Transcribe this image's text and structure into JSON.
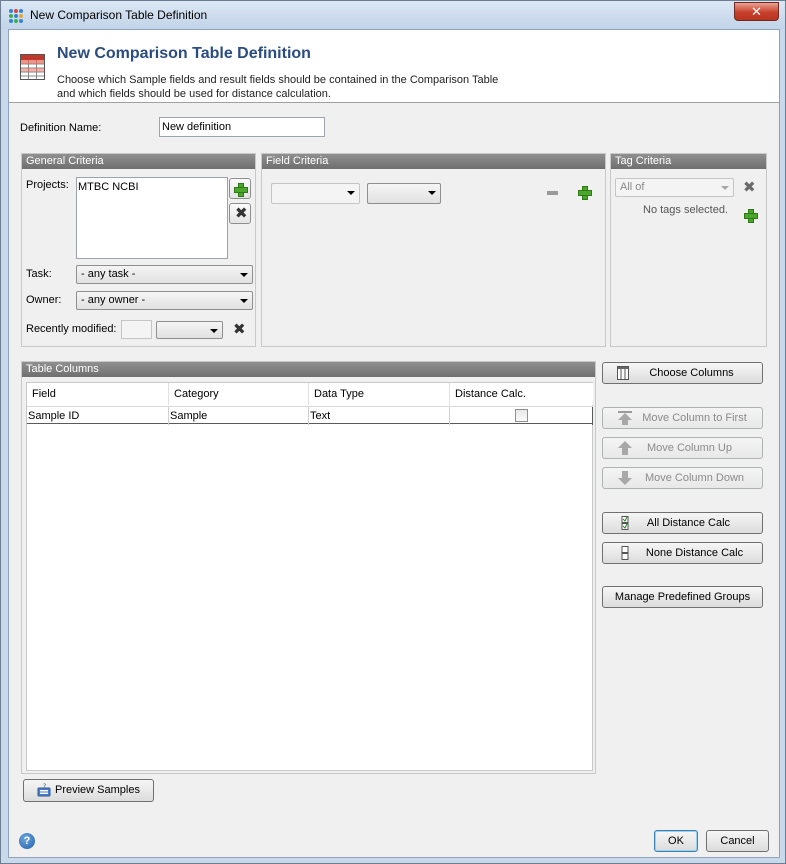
{
  "window": {
    "title": "New Comparison Table Definition",
    "close_glyph": "✕"
  },
  "header": {
    "title": "New Comparison Table Definition",
    "description_line1": "Choose which Sample fields and result fields should be contained in the Comparison Table",
    "description_line2": "and which fields should be used for distance calculation."
  },
  "definition": {
    "label": "Definition Name:",
    "value": "New definition"
  },
  "general_criteria": {
    "title": "General Criteria",
    "projects_label": "Projects:",
    "projects": [
      "MTBC NCBI"
    ],
    "task_label": "Task:",
    "task_value": "- any task -",
    "owner_label": "Owner:",
    "owner_value": "- any owner -",
    "recent_label": "Recently modified:",
    "recent_value": ""
  },
  "field_criteria": {
    "title": "Field Criteria",
    "field_value": "",
    "operator_value": ""
  },
  "tag_criteria": {
    "title": "Tag Criteria",
    "mode_value": "All of",
    "empty_text": "No tags selected."
  },
  "table_columns": {
    "title": "Table Columns",
    "headers": [
      "Field",
      "Category",
      "Data Type",
      "Distance Calc."
    ],
    "rows": [
      {
        "field": "Sample ID",
        "category": "Sample",
        "data_type": "Text",
        "distance_calc": false
      }
    ]
  },
  "side_buttons": {
    "choose_columns": "Choose Columns",
    "move_first": "Move Column to First",
    "move_up": "Move Column Up",
    "move_down": "Move Column Down",
    "all_distance": "All Distance Calc",
    "none_distance": "None Distance Calc",
    "manage_groups": "Manage Predefined Groups"
  },
  "footer": {
    "preview_label": "Preview Samples",
    "ok_label": "OK",
    "cancel_label": "Cancel",
    "help_glyph": "?"
  },
  "icons": {
    "app": "app-dots-icon",
    "header": "table-grid-icon",
    "add": "plus-icon",
    "remove": "x-icon",
    "minus": "minus-icon",
    "help": "help-icon"
  },
  "colors": {
    "accent_title": "#2b4c80",
    "panel_header": "#7a7a7a",
    "add_green": "#49a82b",
    "close_red": "#c7402b"
  }
}
